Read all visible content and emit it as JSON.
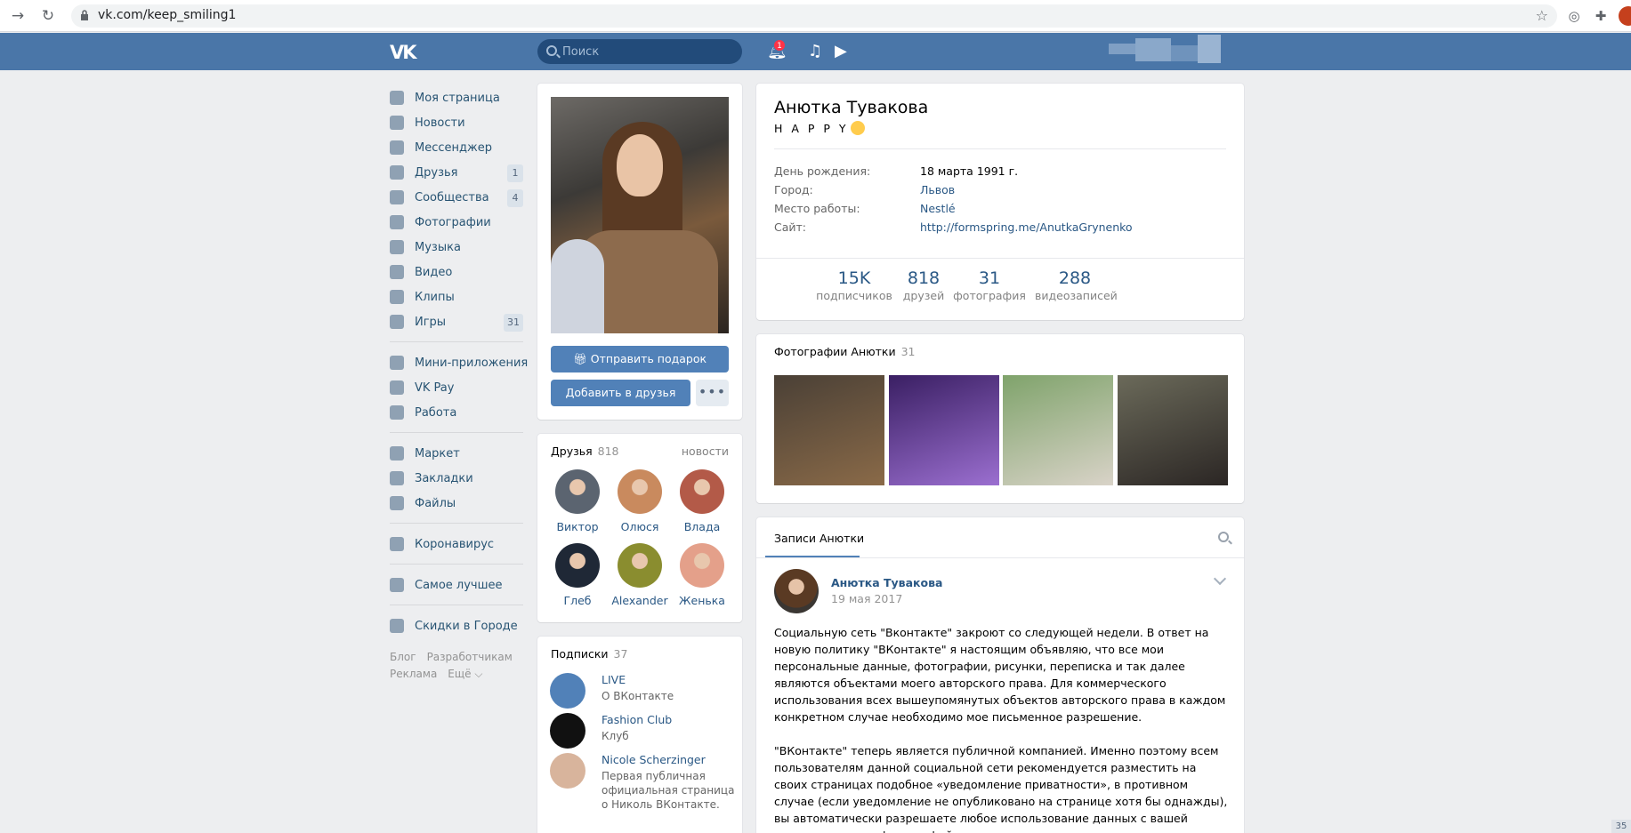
{
  "browser": {
    "url": "vk.com/keep_smiling1"
  },
  "header": {
    "logo": "VK",
    "search_placeholder": "Поиск",
    "notifications_count": "1"
  },
  "sidebar": {
    "items": [
      {
        "label": "Моя страница",
        "icon": "home-icon"
      },
      {
        "label": "Новости",
        "icon": "news-icon"
      },
      {
        "label": "Мессенджер",
        "icon": "messenger-icon"
      },
      {
        "label": "Друзья",
        "icon": "friends-icon",
        "count": "1"
      },
      {
        "label": "Сообщества",
        "icon": "groups-icon",
        "count": "4"
      },
      {
        "label": "Фотографии",
        "icon": "camera-icon"
      },
      {
        "label": "Музыка",
        "icon": "music-icon"
      },
      {
        "label": "Видео",
        "icon": "video-icon"
      },
      {
        "label": "Клипы",
        "icon": "clips-icon"
      },
      {
        "label": "Игры",
        "icon": "games-icon",
        "count": "31"
      }
    ],
    "items2": [
      {
        "label": "Мини-приложения",
        "icon": "apps-icon"
      },
      {
        "label": "VK Pay",
        "icon": "vkpay-icon"
      },
      {
        "label": "Работа",
        "icon": "work-icon"
      }
    ],
    "items3": [
      {
        "label": "Маркет",
        "icon": "market-icon"
      },
      {
        "label": "Закладки",
        "icon": "bookmarks-icon"
      },
      {
        "label": "Файлы",
        "icon": "files-icon"
      }
    ],
    "items4": [
      {
        "label": "Коронавирус",
        "icon": "virus-icon"
      }
    ],
    "items5": [
      {
        "label": "Самое лучшее",
        "icon": "best-icon"
      }
    ],
    "items6": [
      {
        "label": "Скидки в Городе",
        "icon": "discounts-icon"
      }
    ],
    "footer": {
      "blog": "Блог",
      "developers": "Разработчикам",
      "ads": "Реклама",
      "more": "Ещё ⌵"
    }
  },
  "profile": {
    "name": "Анютка Тувакова",
    "status": "H A P P Y",
    "info": [
      {
        "key": "День рождения:",
        "value": "18 марта 1991 г."
      },
      {
        "key": "Город:",
        "value": "Львов"
      },
      {
        "key": "Место работы:",
        "value": "Nestlé"
      },
      {
        "key": "Сайт:",
        "value": "http://formspring.me/AnutkaGrynenko"
      }
    ],
    "stats": [
      {
        "num": "15K",
        "label": "подписчиков"
      },
      {
        "num": "818",
        "label": "друзей"
      },
      {
        "num": "31",
        "label": "фотография"
      },
      {
        "num": "288",
        "label": "видеозаписей"
      }
    ],
    "send_gift": "Отправить подарок",
    "add_friend": "Добавить в друзья",
    "more": "•••"
  },
  "friends": {
    "title": "Друзья",
    "count": "818",
    "link": "новости",
    "list": [
      {
        "name": "Виктор",
        "color": "#5b6470"
      },
      {
        "name": "Олюся",
        "color": "#c98a5e"
      },
      {
        "name": "Влада",
        "color": "#b35a48"
      },
      {
        "name": "Глеб",
        "color": "#1f2836"
      },
      {
        "name": "Alexander",
        "color": "#8a8d2f"
      },
      {
        "name": "Женька",
        "color": "#e4a08a"
      }
    ]
  },
  "subscriptions": {
    "title": "Подписки",
    "count": "37",
    "list": [
      {
        "name": "LIVE",
        "desc": "О ВКонтакте",
        "color": "#5181b8"
      },
      {
        "name": "Fashion Club",
        "desc": "Клуб",
        "color": "#111111"
      },
      {
        "name": "Nicole Scherzinger",
        "desc": "Первая публичная официальная страница о Николь ВКонтакте.",
        "color": "#d8b49c"
      }
    ]
  },
  "photos": {
    "title": "Фотографии Анютки",
    "count": "31",
    "thumbs": [
      {
        "color1": "#4a4036",
        "color2": "#8a6a48"
      },
      {
        "color1": "#3a1f63",
        "color2": "#9b6fd0"
      },
      {
        "color1": "#7fa36b",
        "color2": "#d9d3c8"
      },
      {
        "color1": "#6b6a5a",
        "color2": "#2b2624"
      }
    ]
  },
  "wall": {
    "tab": "Записи Анютки",
    "post": {
      "author": "Анютка Тувакова",
      "date": "19 мая 2017",
      "p1": "Социальную сеть \"Вконтакте\" закроют со следующей недели. В ответ на новую политику \"ВКонтакте\" я настоящим объявляю, что все мои персональные данные, фотографии, рисунки, переписка и так далее являются объектами моего авторского права. Для коммерческого использования всех вышеупомянутых объектов авторского права в каждом конкретном случае необходимо мое письменное разрешение.",
      "p2": "\"ВКонтакте\" теперь является публичной компанией. Именно поэтому всем пользователям данной социальной сети рекомендуется разместить на своих страницах подобное «уведомление приватности», в противном случае (если уведомление не опубликовано на странице хотя бы однажды), вы автоматически разрешаете любое использование данных с вашей страницы, ваших фотографий"
    }
  },
  "scroll_tag": "35"
}
